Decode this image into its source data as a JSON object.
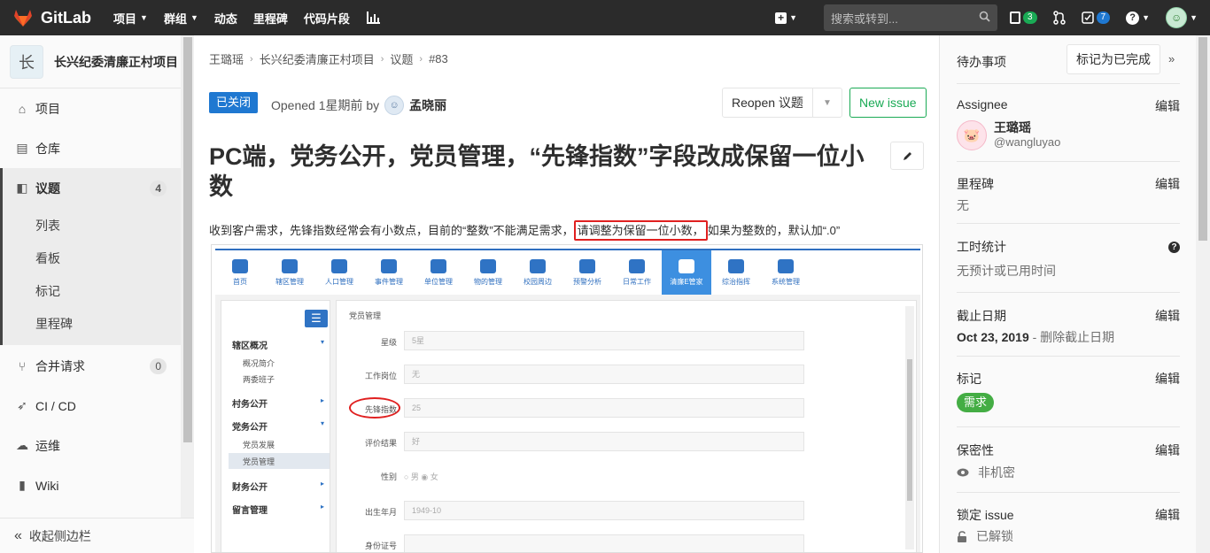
{
  "topnav": {
    "brand": "GitLab",
    "links": [
      "项目",
      "群组",
      "动态",
      "里程碑",
      "代码片段"
    ],
    "search_placeholder": "搜索或转到...",
    "issues_count": "3",
    "todos_count": "7"
  },
  "sidebar": {
    "project_avatar": "长",
    "project_name": "长兴纪委清廉正村项目",
    "items": [
      {
        "label": "项目"
      },
      {
        "label": "仓库"
      },
      {
        "label": "议题",
        "count": "4"
      },
      {
        "label": "合并请求",
        "count": "0"
      },
      {
        "label": "CI / CD"
      },
      {
        "label": "运维"
      },
      {
        "label": "Wiki"
      }
    ],
    "subitems": [
      "列表",
      "看板",
      "标记",
      "里程碑"
    ],
    "collapse": "收起侧边栏"
  },
  "breadcrumb": [
    "王璐瑶",
    "长兴纪委清廉正村项目",
    "议题",
    "#83"
  ],
  "issue": {
    "status": "已关闭",
    "opened_text": "Opened 1星期前 by",
    "author": "孟晓丽",
    "reopen_label": "Reopen 议题",
    "new_issue_label": "New issue",
    "title": "PC端，党务公开，党员管理，“先锋指数”字段改成保留一位小数",
    "desc_before": "收到客户需求，先锋指数经常会有小数点，目前的“整数”不能满足需求，",
    "desc_highlight": "请调整为保留一位小数，",
    "desc_after": "如果为整数的，默认加“.0”"
  },
  "embedded": {
    "nav": [
      "首页",
      "辖区管理",
      "人口管理",
      "事件管理",
      "单位管理",
      "物的管理",
      "校园周边",
      "预警分析",
      "日常工作",
      "清廉E管家",
      "综治指挥",
      "系统管理"
    ],
    "menu_toggle": "☰",
    "menu": [
      {
        "label": "辖区概况",
        "arrow": "▾"
      },
      {
        "label": "村务公开",
        "arrow": "▸"
      },
      {
        "label": "党务公开",
        "arrow": "▾"
      },
      {
        "label": "财务公开",
        "arrow": "▸"
      },
      {
        "label": "留言管理",
        "arrow": "▸"
      }
    ],
    "submenu": [
      "概况简介",
      "两委班子",
      "党员发展",
      "党员管理"
    ],
    "form_title": "党员管理",
    "fields": [
      {
        "label": "星级",
        "value": "5星"
      },
      {
        "label": "工作岗位",
        "value": "无"
      },
      {
        "label": "先锋指数",
        "value": "25"
      },
      {
        "label": "评价结果",
        "value": "好"
      },
      {
        "label": "性别",
        "value": "○ 男    ◉ 女"
      },
      {
        "label": "出生年月",
        "value": "1949-10"
      },
      {
        "label": "身份证号",
        "value": ""
      }
    ]
  },
  "right": {
    "todo": "待办事项",
    "mark_done": "标记为已完成",
    "collapse_icon": "»",
    "edit": "编辑",
    "assignee_label": "Assignee",
    "assignee_name": "王璐瑶",
    "assignee_user": "@wangluyao",
    "milestone_label": "里程碑",
    "milestone_value": "无",
    "time_label": "工时统计",
    "time_value": "无预计或已用时间",
    "due_label": "截止日期",
    "due_date": "Oct 23, 2019",
    "due_remove": " - 删除截止日期",
    "labels_label": "标记",
    "label_name": "需求",
    "conf_label": "保密性",
    "conf_value": "非机密",
    "lock_label": "锁定 issue",
    "lock_value": "已解锁"
  }
}
